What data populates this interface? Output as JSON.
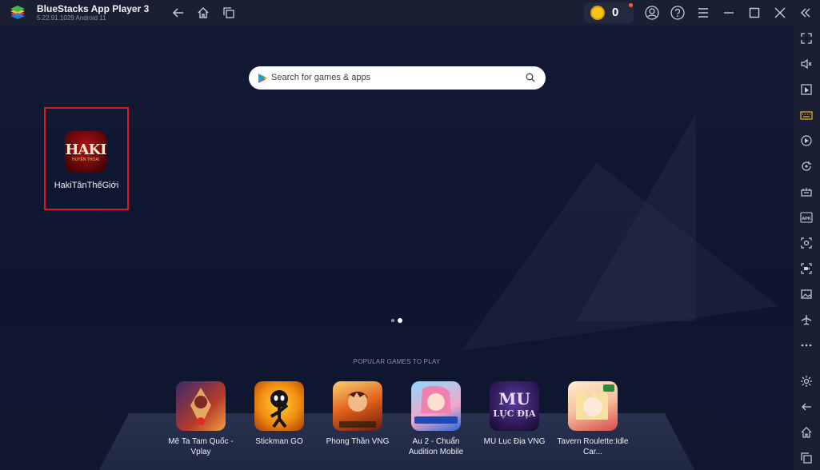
{
  "titlebar": {
    "title": "BlueStacks App Player 3",
    "version": "5.22.91.1029  Android 11",
    "coins": "0"
  },
  "search": {
    "placeholder": "Search for games & apps"
  },
  "installed_app": {
    "name": "HakiTânThếGiới",
    "icon_text": "HAKI",
    "icon_subtext": "HUYỀN THOẠI"
  },
  "popular": {
    "title": "POPULAR GAMES TO PLAY",
    "games": [
      {
        "label": "Mê Ta Tam Quốc - Vplay"
      },
      {
        "label": "Stickman GO"
      },
      {
        "label": "Phong Thần VNG"
      },
      {
        "label": "Au 2 - Chuẩn Audition Mobile"
      },
      {
        "label": "MU Lục Địa VNG"
      },
      {
        "label": "Tavern Roulette:Idle Car..."
      }
    ],
    "game_icon_texts": [
      "MU",
      "LỤC ĐỊA"
    ]
  },
  "colors": {
    "accent_highlight": "#e01515",
    "titlebar_bg": "#1a1f33",
    "main_bg": "#0f1529"
  },
  "icons": {
    "titlebar": [
      "back-icon",
      "home-icon",
      "multi-instance-icon",
      "account-icon",
      "help-icon",
      "menu-icon",
      "minimize-icon",
      "maximize-icon",
      "close-icon",
      "collapse-sidebar-icon"
    ],
    "sidebar": [
      "fullscreen-icon",
      "volume-icon",
      "media-folder-icon",
      "keyboard-icon",
      "macro-icon",
      "rotate-icon",
      "multi-instance-manager-icon",
      "apk-install-icon",
      "screenshot-icon",
      "record-icon",
      "media-manager-icon",
      "airplane-mode-icon",
      "more-icon",
      "settings-icon",
      "back-icon",
      "home-icon",
      "recent-apps-icon"
    ]
  }
}
